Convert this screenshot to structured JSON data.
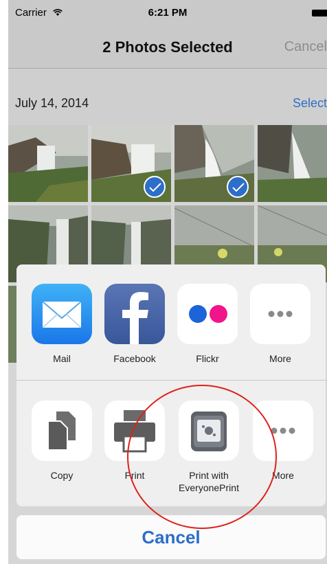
{
  "status_bar": {
    "carrier": "Carrier",
    "time": "6:21 PM"
  },
  "nav": {
    "title": "2 Photos Selected",
    "cancel_label": "Cancel"
  },
  "section": {
    "date": "July 14, 2014",
    "select_label": "Select"
  },
  "photos": [
    {
      "selected": false
    },
    {
      "selected": true
    },
    {
      "selected": true
    },
    {
      "selected": false
    },
    {
      "selected": false
    },
    {
      "selected": false
    },
    {
      "selected": false
    },
    {
      "selected": false
    }
  ],
  "share_sheet": {
    "apps": [
      {
        "label": "Mail",
        "icon": "mail-icon"
      },
      {
        "label": "Facebook",
        "icon": "facebook-icon"
      },
      {
        "label": "Flickr",
        "icon": "flickr-icon"
      },
      {
        "label": "More",
        "icon": "more-icon"
      }
    ],
    "actions": [
      {
        "label": "Copy",
        "icon": "copy-icon"
      },
      {
        "label": "Print",
        "icon": "printer-icon"
      },
      {
        "label": "Print with\nEveryonePrint",
        "icon": "everyoneprint-icon"
      },
      {
        "label": "More",
        "icon": "more-icon"
      }
    ],
    "cancel_label": "Cancel"
  },
  "colors": {
    "accent": "#2c6ec9",
    "annotation": "#e0201b"
  }
}
